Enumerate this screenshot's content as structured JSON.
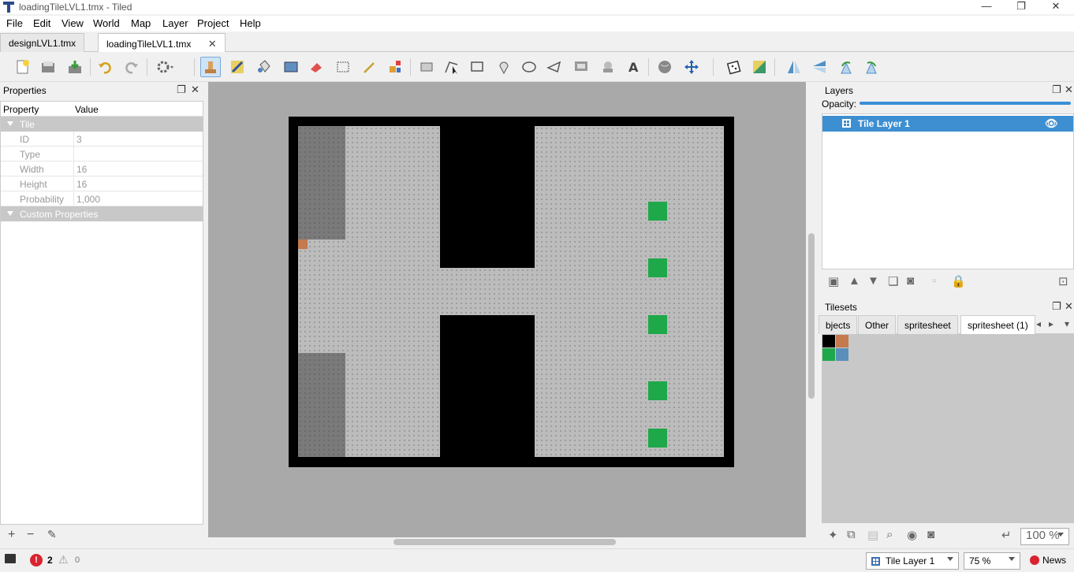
{
  "window": {
    "title": "loadingTileLVL1.tmx - Tiled",
    "min": "—",
    "max": "❐",
    "close": "✕"
  },
  "menu": [
    "File",
    "Edit",
    "View",
    "World",
    "Map",
    "Layer",
    "Project",
    "Help"
  ],
  "doc_tabs": [
    {
      "label": "designLVL1.tmx",
      "active": false
    },
    {
      "label": "loadingTileLVL1.tmx",
      "active": true
    }
  ],
  "toolbar": {
    "icons": [
      "new-map-icon",
      "open-icon",
      "save-icon",
      "undo-icon",
      "redo-icon",
      "commands-icon",
      "stamp-brush-icon",
      "terrain-brush-icon",
      "bucket-fill-icon",
      "shape-fill-icon",
      "eraser-icon",
      "rectangular-select-icon",
      "magic-wand-icon",
      "select-same-tile-icon",
      "select-objects-icon",
      "edit-polygons-icon",
      "insert-rectangle-icon",
      "insert-point-icon",
      "insert-ellipse-icon",
      "insert-polygon-icon",
      "insert-tile-icon",
      "insert-template-icon",
      "insert-text-icon",
      "world-tool-icon",
      "move-icon",
      "random-mode-icon",
      "wang-fill-icon",
      "flip-horizontal-icon",
      "flip-vertical-icon",
      "rotate-left-icon",
      "rotate-right-icon"
    ]
  },
  "properties": {
    "title": "Properties",
    "col_property": "Property",
    "col_value": "Value",
    "group_tile": "Tile",
    "rows": [
      {
        "key": "ID",
        "value": "3"
      },
      {
        "key": "Type",
        "value": ""
      },
      {
        "key": "Width",
        "value": "16"
      },
      {
        "key": "Height",
        "value": "16"
      },
      {
        "key": "Probability",
        "value": "1,000"
      }
    ],
    "group_custom": "Custom Properties",
    "footer": {
      "add": "+",
      "remove": "−",
      "edit": "✎"
    }
  },
  "layers": {
    "title": "Layers",
    "opacity_label": "Opacity:",
    "opacity": 1.0,
    "items": [
      {
        "name": "Tile Layer 1",
        "selected": true
      }
    ]
  },
  "tilesets": {
    "title": "Tilesets",
    "tabs": [
      {
        "label": "bjects",
        "active": false
      },
      {
        "label": "Other",
        "active": false
      },
      {
        "label": "spritesheet",
        "active": false
      },
      {
        "label": "spritesheet (1)",
        "active": true
      }
    ],
    "tiles": [
      "#000000",
      "#c47a4e",
      "#1fa84a",
      "#5a8fba"
    ],
    "zoom": "100 %"
  },
  "status": {
    "errors": "2",
    "warnings": "0",
    "layer": "Tile Layer 1",
    "zoom": "75 %",
    "news": "News"
  },
  "colors": {
    "accent": "#3d8fd1",
    "map_floor": "#bcbcbc",
    "map_dark": "#7a7a7a",
    "map_wall": "#000000",
    "green": "#1fa84a",
    "orange": "#c47a4e"
  }
}
